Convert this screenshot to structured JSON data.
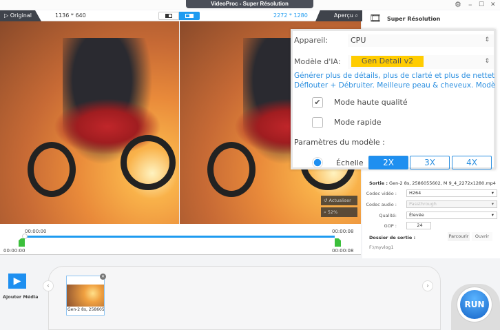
{
  "window": {
    "title": "VideoProc - Super Résolution",
    "gear": "gear-icon",
    "minimize": "–",
    "maximize": "☐",
    "close": "✕"
  },
  "toolbar": {
    "original": "▷ Original",
    "original_res": "1136 * 640",
    "output_res": "2272 * 1280",
    "apercu": "Aperçu"
  },
  "side": {
    "title": "Super Résolution",
    "sortie_label": "Sortie :",
    "sortie_value": "Gen-2 8s, 2586055602, M 9_4_2272x1280.mp4",
    "codec_video_label": "Codec vidéo :",
    "codec_video": "H264",
    "codec_audio_label": "Codec audio :",
    "codec_audio": "Passthrough",
    "qualite_label": "Qualité:",
    "qualite": "Élevée",
    "gop_label": "GOP :",
    "gop": "24",
    "dossier_label": "Dossier de sortie :",
    "parcourir": "Parcourir",
    "ouvrir": "Ouvrir",
    "path": "F:\\myvlog1"
  },
  "popup": {
    "appareil_label": "Appareil:",
    "appareil": "CPU",
    "modele_label": "Modèle d'IA:",
    "modele": "Gen Detail v2",
    "desc1": "Générer plus de détails, plus de clarté et plus de netteté.",
    "desc2": "Déflouter + Débruiter. Meilleure peau & cheveux. Modèle GAN",
    "hq": "Mode haute qualité",
    "rapide": "Mode rapide",
    "params": "Paramètres du modèle :",
    "echelle": "Échelle",
    "scales": [
      "2X",
      "3X",
      "4X"
    ],
    "hq_checked": true,
    "rapide_checked": false,
    "selected_scale": "2X",
    "accent": "#2b8fe0",
    "model_color": "#ffcc00"
  },
  "preview": {
    "actualiser": "Actualiser",
    "zoom": "52%"
  },
  "timeline": {
    "start_top": "00:00:00",
    "end_top": "00:00:08",
    "start_bottom": "00:00:00",
    "end_bottom": "00:00:08",
    "progress": 0
  },
  "bottom": {
    "add_media": "Ajouter Média",
    "clip_label": "Gen-2 8s, 258605",
    "run": "RUN"
  }
}
